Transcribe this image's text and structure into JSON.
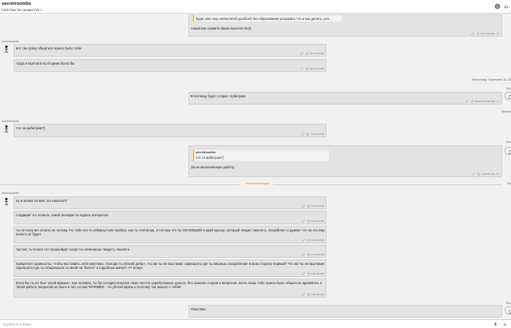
{
  "header": {
    "title": "secretroombs",
    "subtitle": "Click here for contact info >"
  },
  "messages": [
    {
      "quote_text": "будет мне еще наполнятей долбоеб без образование указывать что и как делать, уси…",
      "text": "Ахаха как скажите ваше высочество))",
      "time": "10:17 AM (1D)"
    },
    {
      "sender": "secretroombs",
      "text": "вот так сразу общаться нужно было тебе",
      "time": "10:17 AM (1D)"
    },
    {
      "text": "тогда и выплата во вторник была бы",
      "time": "10:18 AM (1D)"
    },
    {
      "date": "Wednesday, September 16, 20"
    },
    {
      "text": "В пятницу будет открыт Арбитраж.",
      "time": "Edited 6:15 AM (1D)",
      "side_label": "Sec"
    },
    {
      "date": "Yesterd"
    },
    {
      "sender": "secretroombs",
      "text": "что за арбитраж?)",
      "time": "7:10 PM (1D)"
    },
    {
      "quote_name": "secretroombs",
      "quote_text": "что за арбитраж?)",
      "text": "За не выплаченную работу.",
      "time": "8:29 PM (1D)",
      "side_label": "Sec"
    },
    {
      "unread_label": "Unread Messages",
      "date": "Tod"
    },
    {
      "sender": "secretroombs",
      "text": "ну и зачем ты мне это написал?",
      "time": "3:11 AM (1D)"
    },
    {
      "text": "создавай что хочешь, какой реакции ты ждешь интересно",
      "time": "3:11 AM (1D)"
    },
    {
      "text": "ты не получил оплату не потому что тебя кто-то обманул или наебал, как ты считаешь, а потому что ты ОХУЕВШИЙ в край курьер, который пиздит лишнего, оскорбляет и думает что за это ему ничего не будет",
      "time": "4:24 AM (1D)"
    },
    {
      "text": "так вот, ты понял что произойдет когда ты начинаешь пиздеть лишнего",
      "time": "4:27 AM (1D)"
    },
    {
      "text": "прикрепил скриншоты, чтобы выставить себя жертвою, господи ты убогий дебил, что же ты не выставил скриншоты где ты пишешь оскорбления в мою сторону первый? Что же ты не выставил скриншоты где ты общаешься со мной на \"Блять\" и подобных матах? А? Клоун",
      "time": "4:28 AM (1D)"
    },
    {
      "text": "Если бы ты не был такой мразью - как человек, ты бы сегодня получил свою честно заработанные деньги, без лишних споров и вопросов, всего лишь тебе нужно было общаться адекватно, к твоей работе вопросов не было и нет, но как ЧЕЛОВЕК - ты убогая мразь и поэтому так вышло с тобой",
      "time": "4:30 AM (1D)"
    },
    {
      "text": "Пока Ван.",
      "time": "",
      "side_label": "Sec"
    }
  ],
  "composer": {
    "placeholder": "Expires in 5 Days"
  },
  "icons": {
    "info": "info-icon",
    "bell": "bell-icon",
    "mic": "microphone-icon",
    "attach": "attach-icon",
    "avatar": "avatar-icon",
    "edit": "edit-icon",
    "star": "star-icon",
    "check": "double-check-icon"
  },
  "colors": {
    "quote_accent": "#e8a21a",
    "unread_label": "#e58a2b",
    "bubble": "#e3e3e3",
    "background": "#f1f1f1"
  }
}
